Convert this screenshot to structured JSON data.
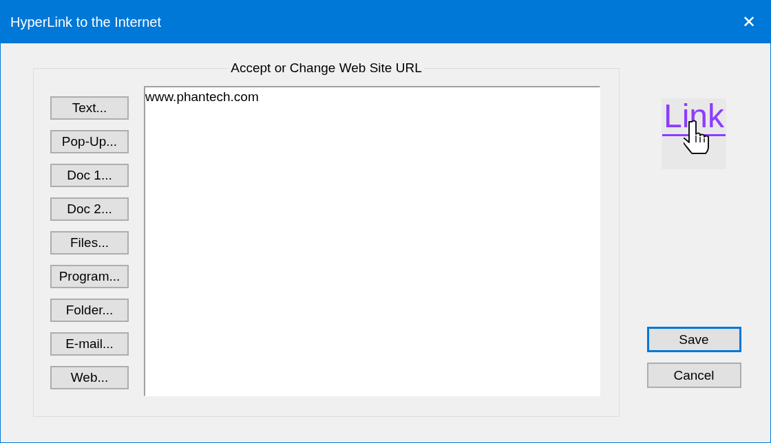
{
  "window": {
    "title": "HyperLink to the Internet",
    "close": "✕"
  },
  "group": {
    "legend": "Accept or Change Web Site URL"
  },
  "link_buttons": [
    "Text...",
    "Pop-Up...",
    "Doc 1...",
    "Doc 2...",
    "Files...",
    "Program...",
    "Folder...",
    "E-mail...",
    "Web..."
  ],
  "url_field": {
    "value": "www.phantech.com"
  },
  "logo": {
    "text": "Link"
  },
  "actions": [
    {
      "label": "Save",
      "default": true
    },
    {
      "label": "Cancel",
      "default": false
    }
  ]
}
